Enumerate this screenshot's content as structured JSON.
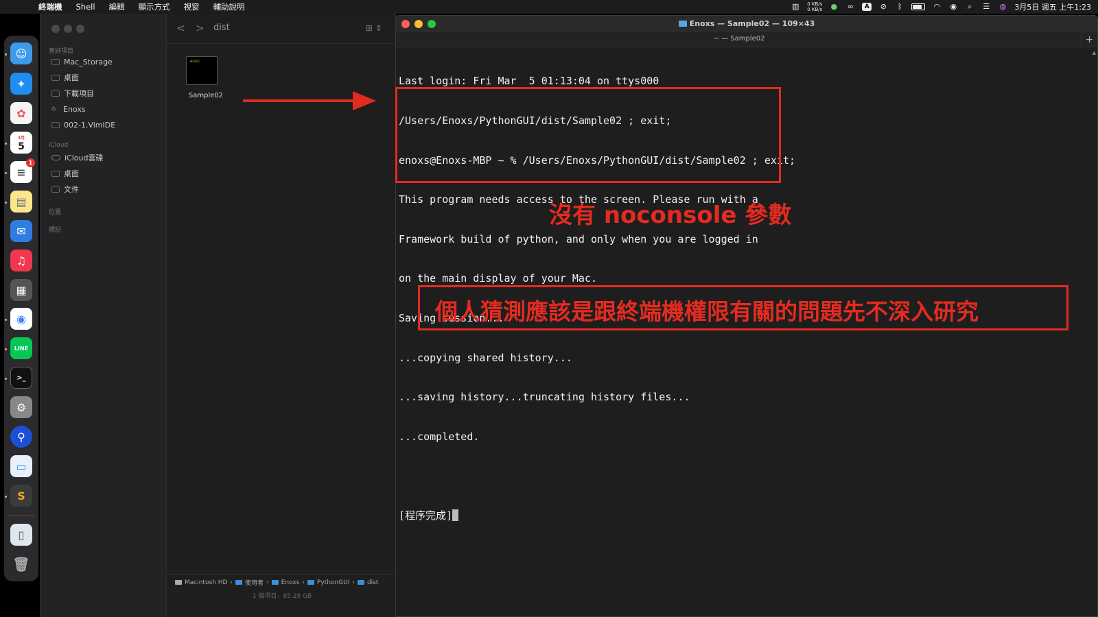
{
  "menubar": {
    "app_name": "終端機",
    "items": [
      "Shell",
      "編輯",
      "顯示方式",
      "視窗",
      "輔助說明"
    ],
    "net_up": "0 KB/s",
    "net_down": "0 KB/s",
    "datetime": "3月5日 週五 上午1:23"
  },
  "dock": {
    "calendar_month": "3月",
    "calendar_day": "5",
    "reminders_badge": "1",
    "line_label": "LINE"
  },
  "finder": {
    "sidebar": {
      "favorites_header": "喜好項目",
      "favorites": [
        "Mac_Storage",
        "桌面",
        "下載項目",
        "Enoxs",
        "002-1.VimIDE"
      ],
      "icloud_header": "iCloud",
      "icloud_items": [
        "iCloud雲碟",
        "桌面",
        "文件"
      ],
      "locations_header": "位置",
      "tags_header": "標記"
    },
    "folder_title": "dist",
    "file": {
      "name": "Sample02",
      "thumb_label": "exec"
    },
    "pathbar": [
      "Macintosh HD",
      "使用者",
      "Enoxs",
      "PythonGUI",
      "dist"
    ],
    "status": "1 個項目，85.28 GB"
  },
  "terminal": {
    "title": "Enoxs — Sample02 — 109×43",
    "tab_title": "~ — Sample02",
    "lines": [
      "Last login: Fri Mar  5 01:13:04 on ttys000",
      "/Users/Enoxs/PythonGUI/dist/Sample02 ; exit;",
      "enoxs@Enoxs-MBP ~ % /Users/Enoxs/PythonGUI/dist/Sample02 ; exit;",
      "This program needs access to the screen. Please run with a",
      "Framework build of python, and only when you are logged in",
      "on the main display of your Mac.",
      "Saving session...",
      "...copying shared history...",
      "...saving history...truncating history files...",
      "...completed.",
      "",
      "[程序完成]"
    ]
  },
  "annotations": {
    "no_console": "沒有 noconsole 參數",
    "guess": "個人猜測應該是跟終端機權限有關的問題先不深入研究"
  },
  "colors": {
    "annotation_red": "#e52b20",
    "terminal_bg": "#1e1e1e",
    "close": "#ff5f57",
    "minimize": "#febc2e",
    "zoom": "#28c840"
  }
}
